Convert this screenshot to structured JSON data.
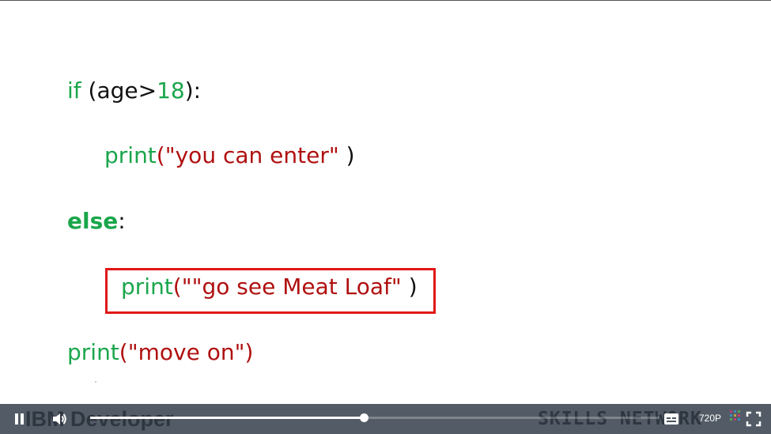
{
  "code": {
    "line1": {
      "kw": "if",
      "open": " (age>",
      "num": "18",
      "close": "):"
    },
    "line2": {
      "fn": "print",
      "open": "(",
      "str": "\"you can enter\"",
      "close": " )"
    },
    "line3": {
      "kw": "else",
      "colon": ":"
    },
    "line4": {
      "fn": "print",
      "open": "(",
      "str": "\"\"go see Meat Loaf\"",
      "close": " )"
    },
    "line5": {
      "fn": "print",
      "open": "(",
      "str": "\"move on\"",
      "close": ")"
    }
  },
  "highlight_color": "#e01818",
  "syntax_colors": {
    "keyword": "#1aa64b",
    "string": "#b01010",
    "plain": "#111111"
  },
  "player": {
    "watermark_left": "IBM Developer",
    "watermark_right": "SKILLS NETWORK",
    "quality": "720P",
    "progress": 0.48,
    "icons": [
      "pause-icon",
      "volume-icon",
      "captions-icon",
      "fullscreen-icon"
    ]
  }
}
